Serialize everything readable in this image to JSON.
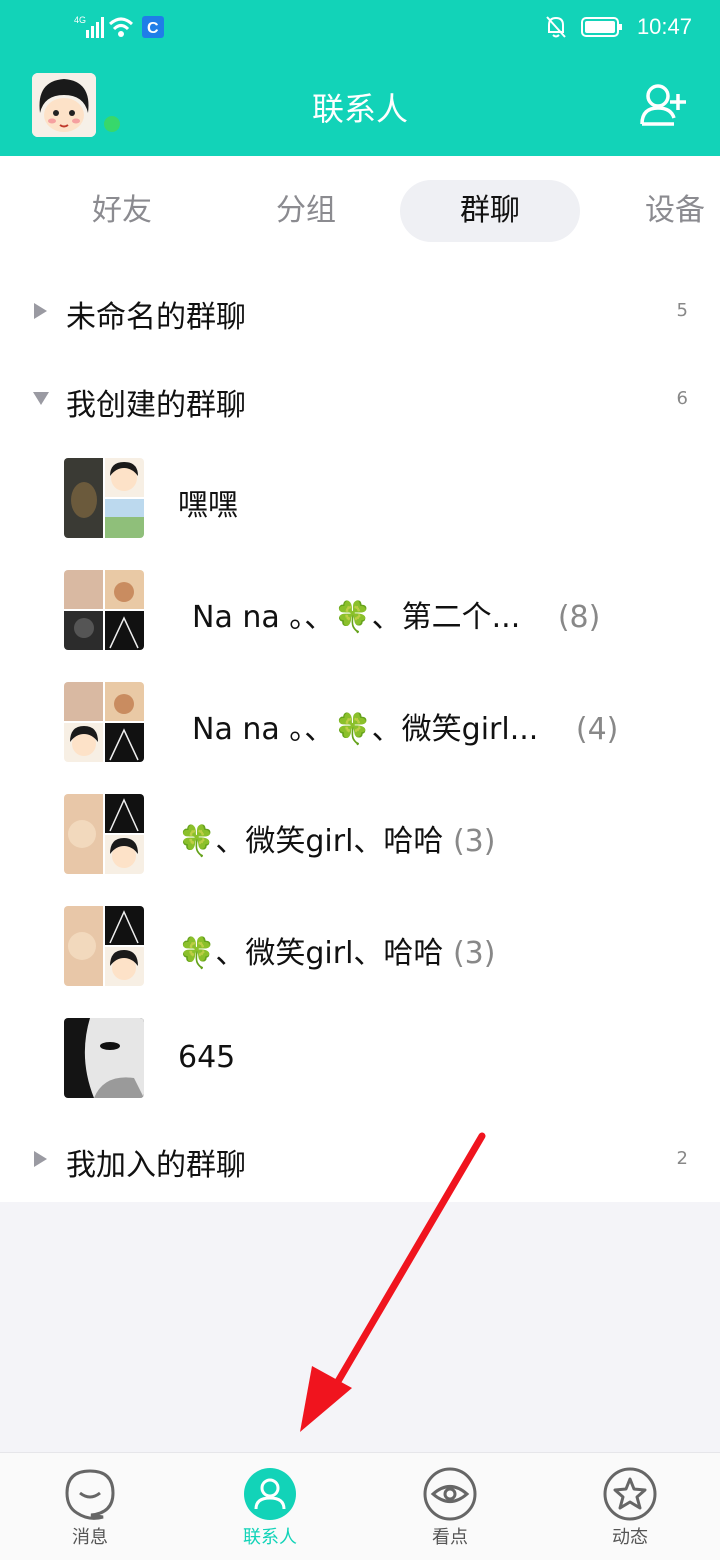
{
  "status_bar": {
    "network": "4G",
    "time": "10:47"
  },
  "header": {
    "title": "联系人"
  },
  "tabs": [
    {
      "label": "好友"
    },
    {
      "label": "分组"
    },
    {
      "label": "群聊",
      "active": true
    },
    {
      "label": "设备"
    }
  ],
  "groups": {
    "unnamed": {
      "name": "未命名的群聊",
      "count": "5",
      "expanded": false
    },
    "created": {
      "name": "我创建的群聊",
      "count": "6",
      "expanded": true
    },
    "joined": {
      "name": "我加入的群聊",
      "count": "2",
      "expanded": false
    }
  },
  "chats": [
    {
      "name": "嘿嘿",
      "count": ""
    },
    {
      "name": "Na  na 。、🍀、第二个...",
      "count": "(8)"
    },
    {
      "name": "Na  na 。、🍀、微笑girl...",
      "count": "(4)"
    },
    {
      "name": "🍀、微笑girl、哈哈",
      "count": "(3)"
    },
    {
      "name": "🍀、微笑girl、哈哈",
      "count": "(3)"
    },
    {
      "name": "645",
      "count": ""
    }
  ],
  "bottom_nav": [
    {
      "label": "消息"
    },
    {
      "label": "联系人",
      "active": true
    },
    {
      "label": "看点"
    },
    {
      "label": "动态"
    }
  ],
  "colors": {
    "accent": "#12d3b8",
    "annotation_arrow": "#f0141e"
  }
}
